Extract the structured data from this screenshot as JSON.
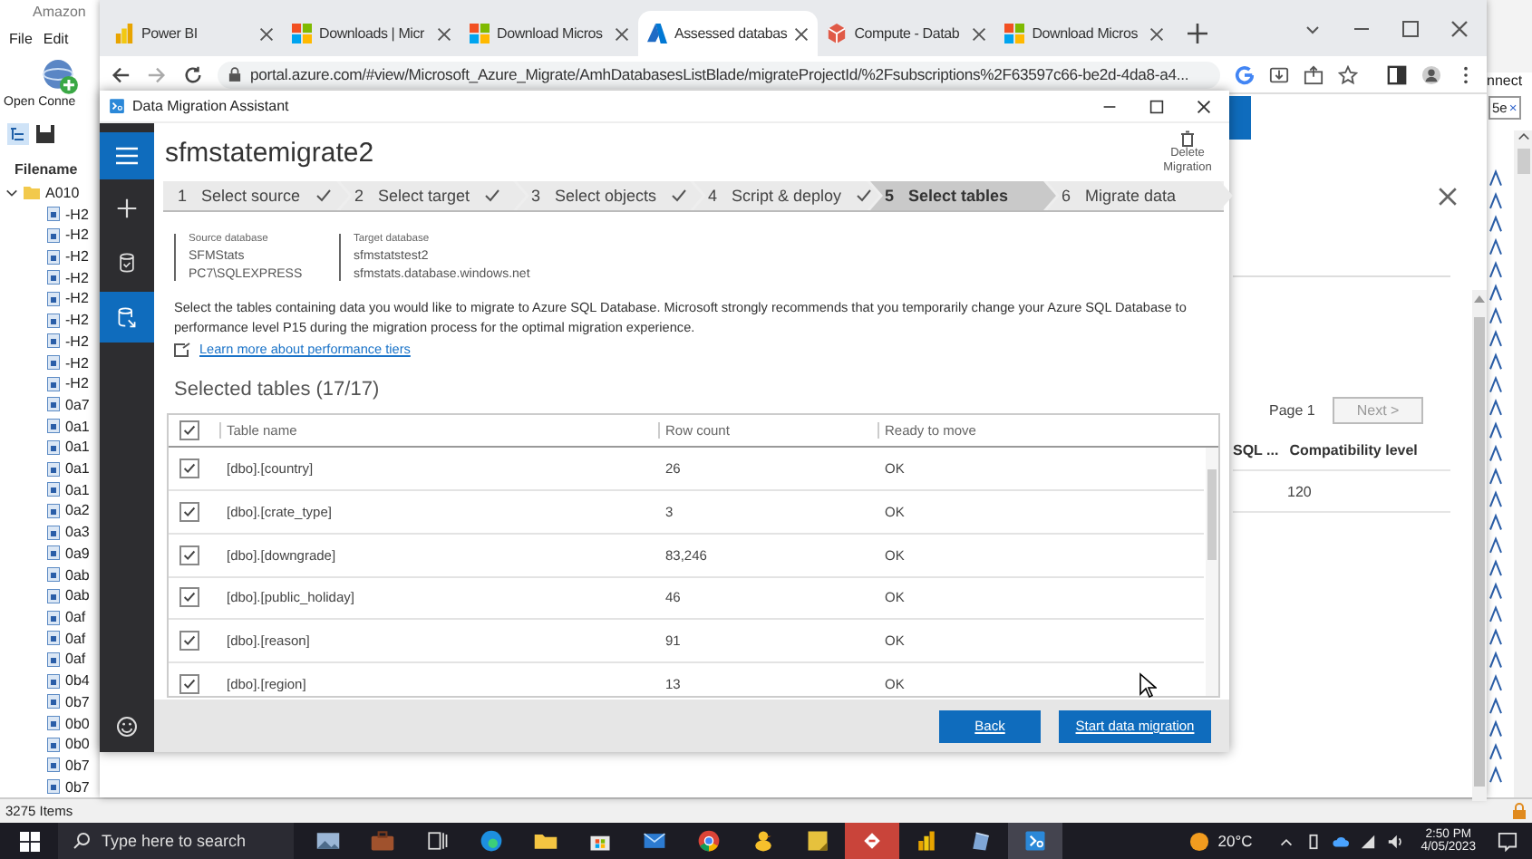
{
  "background_app": {
    "title": "Amazon",
    "menu": [
      "File",
      "Edit"
    ],
    "toolbar_label": "Open Conne",
    "column_header": "Filename",
    "tree": [
      {
        "label": "A010",
        "expanded": true,
        "children": [
          {
            "label": "-H2"
          },
          {
            "label": "-H2"
          },
          {
            "label": "-H2"
          },
          {
            "label": "-H2"
          },
          {
            "label": "-H2"
          },
          {
            "label": "-H2"
          },
          {
            "label": "-H2"
          },
          {
            "label": "-H2"
          },
          {
            "label": "-H2"
          },
          {
            "label": "0a7"
          },
          {
            "label": "0a1"
          },
          {
            "label": "0a1"
          },
          {
            "label": "0a1"
          },
          {
            "label": "0a1"
          },
          {
            "label": "0a2"
          },
          {
            "label": "0a3"
          },
          {
            "label": "0a9"
          },
          {
            "label": "0ab"
          },
          {
            "label": "0ab"
          },
          {
            "label": "0af"
          },
          {
            "label": "0af"
          },
          {
            "label": "0af"
          },
          {
            "label": "0b4"
          },
          {
            "label": "0b7"
          },
          {
            "label": "0b0"
          },
          {
            "label": "0b0"
          },
          {
            "label": "0b7"
          },
          {
            "label": "0b7"
          }
        ]
      }
    ],
    "status": "3275 Items",
    "right_label": "nnect",
    "right_field": "5e",
    "right_field_close": "×"
  },
  "browser": {
    "tabs": [
      {
        "title": "Power BI",
        "kind": "powerbi",
        "selected": false
      },
      {
        "title": "Downloads | Micr",
        "kind": "windows",
        "selected": false
      },
      {
        "title": "Download Micros",
        "kind": "windows",
        "selected": false
      },
      {
        "title": "Assessed databas",
        "kind": "azure",
        "selected": true
      },
      {
        "title": "Compute - Datab",
        "kind": "cube",
        "selected": false
      },
      {
        "title": "Download Micros",
        "kind": "windows",
        "selected": false
      }
    ],
    "url": "portal.azure.com/#view/Microsoft_Azure_Migrate/AmhDatabasesListBlade/migrateProjectId/%2Fsubscriptions%2F63597c66-be2d-4da8-a4...",
    "page": {
      "pager": {
        "page": "Page 1",
        "next": "Next >"
      },
      "columns": [
        "SQL ...",
        "Compatibility level"
      ],
      "rows": [
        {
          "compatibility_level": "120"
        }
      ]
    }
  },
  "dma": {
    "title": "Data Migration Assistant",
    "project": "sfmstatemigrate2",
    "delete_label": "Delete Migration",
    "nav": [
      {
        "kind": "new",
        "selected": false
      },
      {
        "kind": "assessment",
        "selected": false
      },
      {
        "kind": "migration",
        "selected": true
      }
    ],
    "steps": [
      {
        "number": "1",
        "label": "Select source",
        "done": true,
        "selected": false
      },
      {
        "number": "2",
        "label": "Select target",
        "done": true,
        "selected": false
      },
      {
        "number": "3",
        "label": "Select objects",
        "done": true,
        "selected": false
      },
      {
        "number": "4",
        "label": "Script & deploy",
        "done": true,
        "selected": false
      },
      {
        "number": "5",
        "label": "Select tables",
        "done": false,
        "selected": true
      },
      {
        "number": "6",
        "label": "Migrate data",
        "done": false,
        "selected": false
      }
    ],
    "source": {
      "heading": "Source database",
      "name": "SFMStats",
      "server": "PC7\\SQLEXPRESS"
    },
    "target": {
      "heading": "Target database",
      "name": "sfmstatstest2",
      "server": "sfmstats.database.windows.net"
    },
    "description": "Select the tables containing data you would like to migrate to Azure SQL Database. Microsoft strongly recommends that you temporarily change your Azure SQL Database to performance level P15 during the migration process for the optimal migration experience.",
    "link": "Learn more about performance tiers",
    "tables_heading": "Selected tables (17/17)",
    "table": {
      "all_checked": true,
      "columns": [
        "Table name",
        "Row count",
        "Ready to move"
      ],
      "rows": [
        {
          "name": "[dbo].[country]",
          "row_count": "26",
          "ready": "OK",
          "checked": true
        },
        {
          "name": "[dbo].[crate_type]",
          "row_count": "3",
          "ready": "OK",
          "checked": true
        },
        {
          "name": "[dbo].[downgrade]",
          "row_count": "83,246",
          "ready": "OK",
          "checked": true
        },
        {
          "name": "[dbo].[public_holiday]",
          "row_count": "46",
          "ready": "OK",
          "checked": true
        },
        {
          "name": "[dbo].[reason]",
          "row_count": "91",
          "ready": "OK",
          "checked": true
        },
        {
          "name": "[dbo].[region]",
          "row_count": "13",
          "ready": "OK",
          "checked": true
        }
      ]
    },
    "buttons": [
      {
        "label": "Back",
        "kind": "secondary"
      },
      {
        "label": "Start data migration",
        "kind": "primary"
      }
    ]
  },
  "taskbar": {
    "search_placeholder": "Type here to search",
    "apps": [
      {
        "kind": "photo",
        "selected": false
      },
      {
        "kind": "briefcase",
        "selected": false
      },
      {
        "kind": "taskview",
        "selected": false
      },
      {
        "kind": "edge",
        "selected": false
      },
      {
        "kind": "folder",
        "selected": false
      },
      {
        "kind": "store",
        "selected": false
      },
      {
        "kind": "mail",
        "selected": false
      },
      {
        "kind": "chrome",
        "selected": false
      },
      {
        "kind": "duck",
        "selected": false
      },
      {
        "kind": "notes",
        "selected": false
      },
      {
        "kind": "redapp",
        "selected": true
      },
      {
        "kind": "powerbi",
        "selected": false
      },
      {
        "kind": "pen",
        "selected": false
      },
      {
        "kind": "dma",
        "selected": true
      }
    ],
    "temperature": "20°C",
    "time": "2:50 PM",
    "date": "4/05/2023"
  }
}
